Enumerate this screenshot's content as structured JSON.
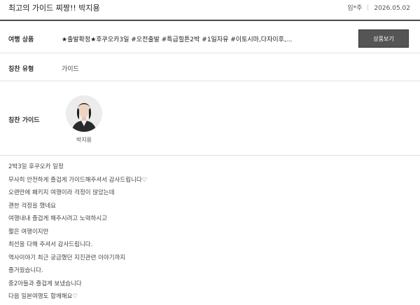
{
  "header": {
    "title": "최고의 가이드 찌짱!! 박지용",
    "author": "임*주",
    "date": "2026.05.02"
  },
  "product": {
    "label": "여행 상품",
    "name": "★출발확정★후쿠오카3일 #오전출발 #특급힐튼2박 #1일자유 #이토시마,다자이후,...",
    "button_label": "상품보기"
  },
  "praise_type": {
    "label": "칭찬 유형",
    "value": "가이드"
  },
  "praise_guide": {
    "label": "칭찬 가이드",
    "name": "박지용"
  },
  "body_lines": [
    "2박3일 후쿠오카 일정",
    "무사히 안전하게 즐겁게 가이드해주셔서 감사드립니다♡",
    "오랜만에 패키지 여행이라 걱정이 많았는데",
    "괜한 걱정을 했네요",
    "여행내내 즐겁게 해주시려고 노력하시고",
    "짧은 여행이지만",
    "최선을 다해 주셔서 감사드립니다.",
    "역사이야기 최근 궁금했던 지진관련 이야기까지",
    "즐거웠습니다.",
    "중2아들과 즐겁게 보냈습니다",
    "다음 일본여행도 함께해요♡"
  ]
}
